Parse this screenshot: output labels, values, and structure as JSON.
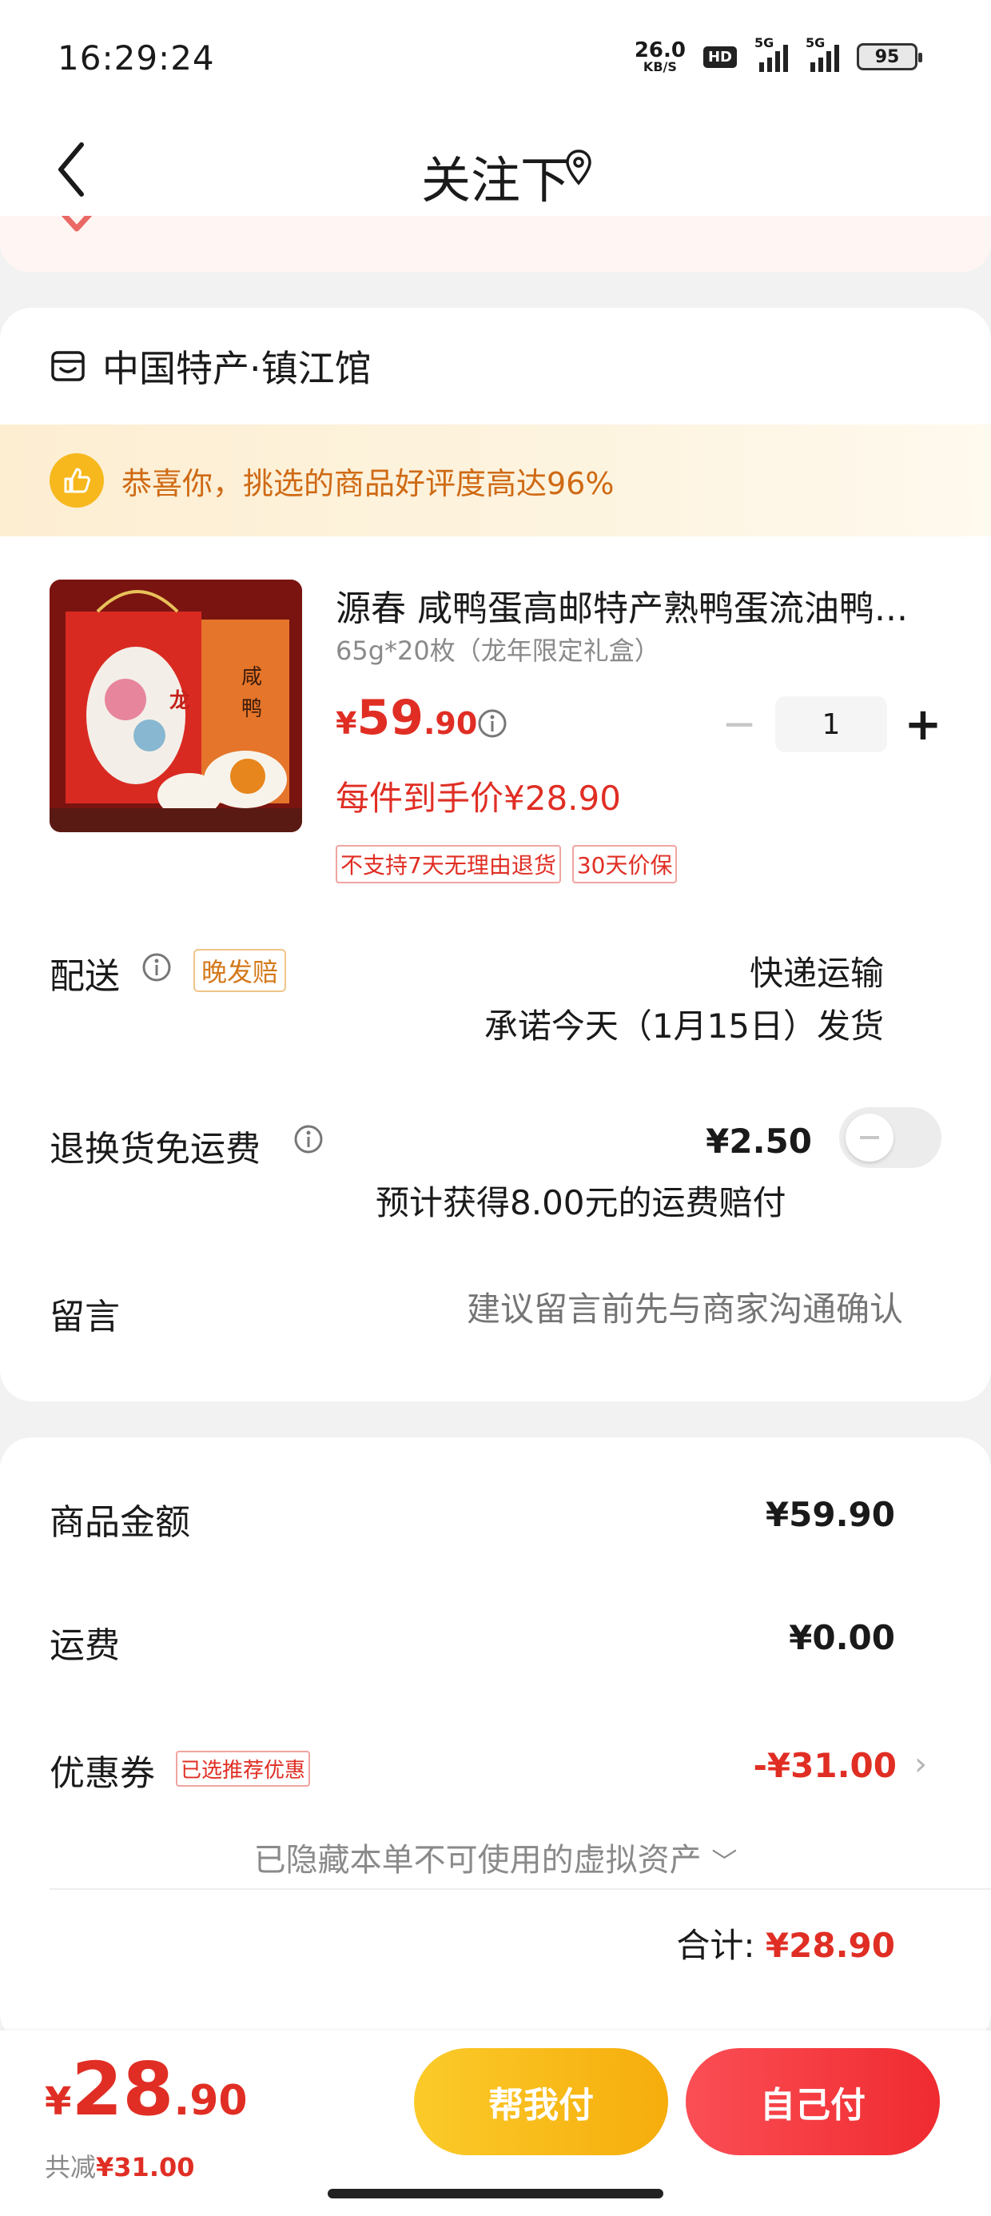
{
  "status_bar": {
    "time": "16:29:24",
    "net_speed_value": "26.0",
    "net_speed_unit": "KB/S",
    "hd_label": "HD",
    "signal1_label": "5G",
    "signal2_label": "5G",
    "battery": "95"
  },
  "header": {
    "title": "关注下"
  },
  "shop": {
    "name": "中国特产·镇江馆",
    "praise": "恭喜你，挑选的商品好评度高达96%"
  },
  "product": {
    "title": "源春 咸鸭蛋高邮特产熟鸭蛋流油鸭...",
    "spec": "65g*20枚（龙年限定礼盒）",
    "price_symbol": "¥",
    "price_int": "59",
    "price_dec": ".90",
    "quantity": "1",
    "unit_price": "每件到手价¥28.90",
    "tags": [
      "不支持7天无理由退货",
      "30天价保"
    ]
  },
  "delivery": {
    "label": "配送",
    "late_tag": "晚发赔",
    "method": "快递运输",
    "promise": "承诺今天（1月15日）发货"
  },
  "return_shipping": {
    "label": "退换货免运费",
    "price": "¥2.50",
    "compensation": "预计获得8.00元的运费赔付",
    "enabled": false
  },
  "note": {
    "label": "留言",
    "placeholder": "建议留言前先与商家沟通确认"
  },
  "summary": {
    "goods_label": "商品金额",
    "goods_value": "¥59.90",
    "shipping_label": "运费",
    "shipping_value": "¥0.00",
    "coupon_label": "优惠券",
    "coupon_tag": "已选推荐优惠",
    "coupon_value": "-¥31.00",
    "hidden_assets": "已隐藏本单不可使用的虚拟资产",
    "total_label": "合计:",
    "total_value": "¥28.90"
  },
  "bottom_bar": {
    "price_symbol": "¥",
    "price_int": "28",
    "price_dec": ".90",
    "saved_label": "共减",
    "saved_value": "¥31.00",
    "help_pay_label": "帮我付",
    "self_pay_label": "自己付"
  },
  "colors": {
    "accent_red": "#e02e24",
    "accent_yellow": "#f6b81d"
  }
}
